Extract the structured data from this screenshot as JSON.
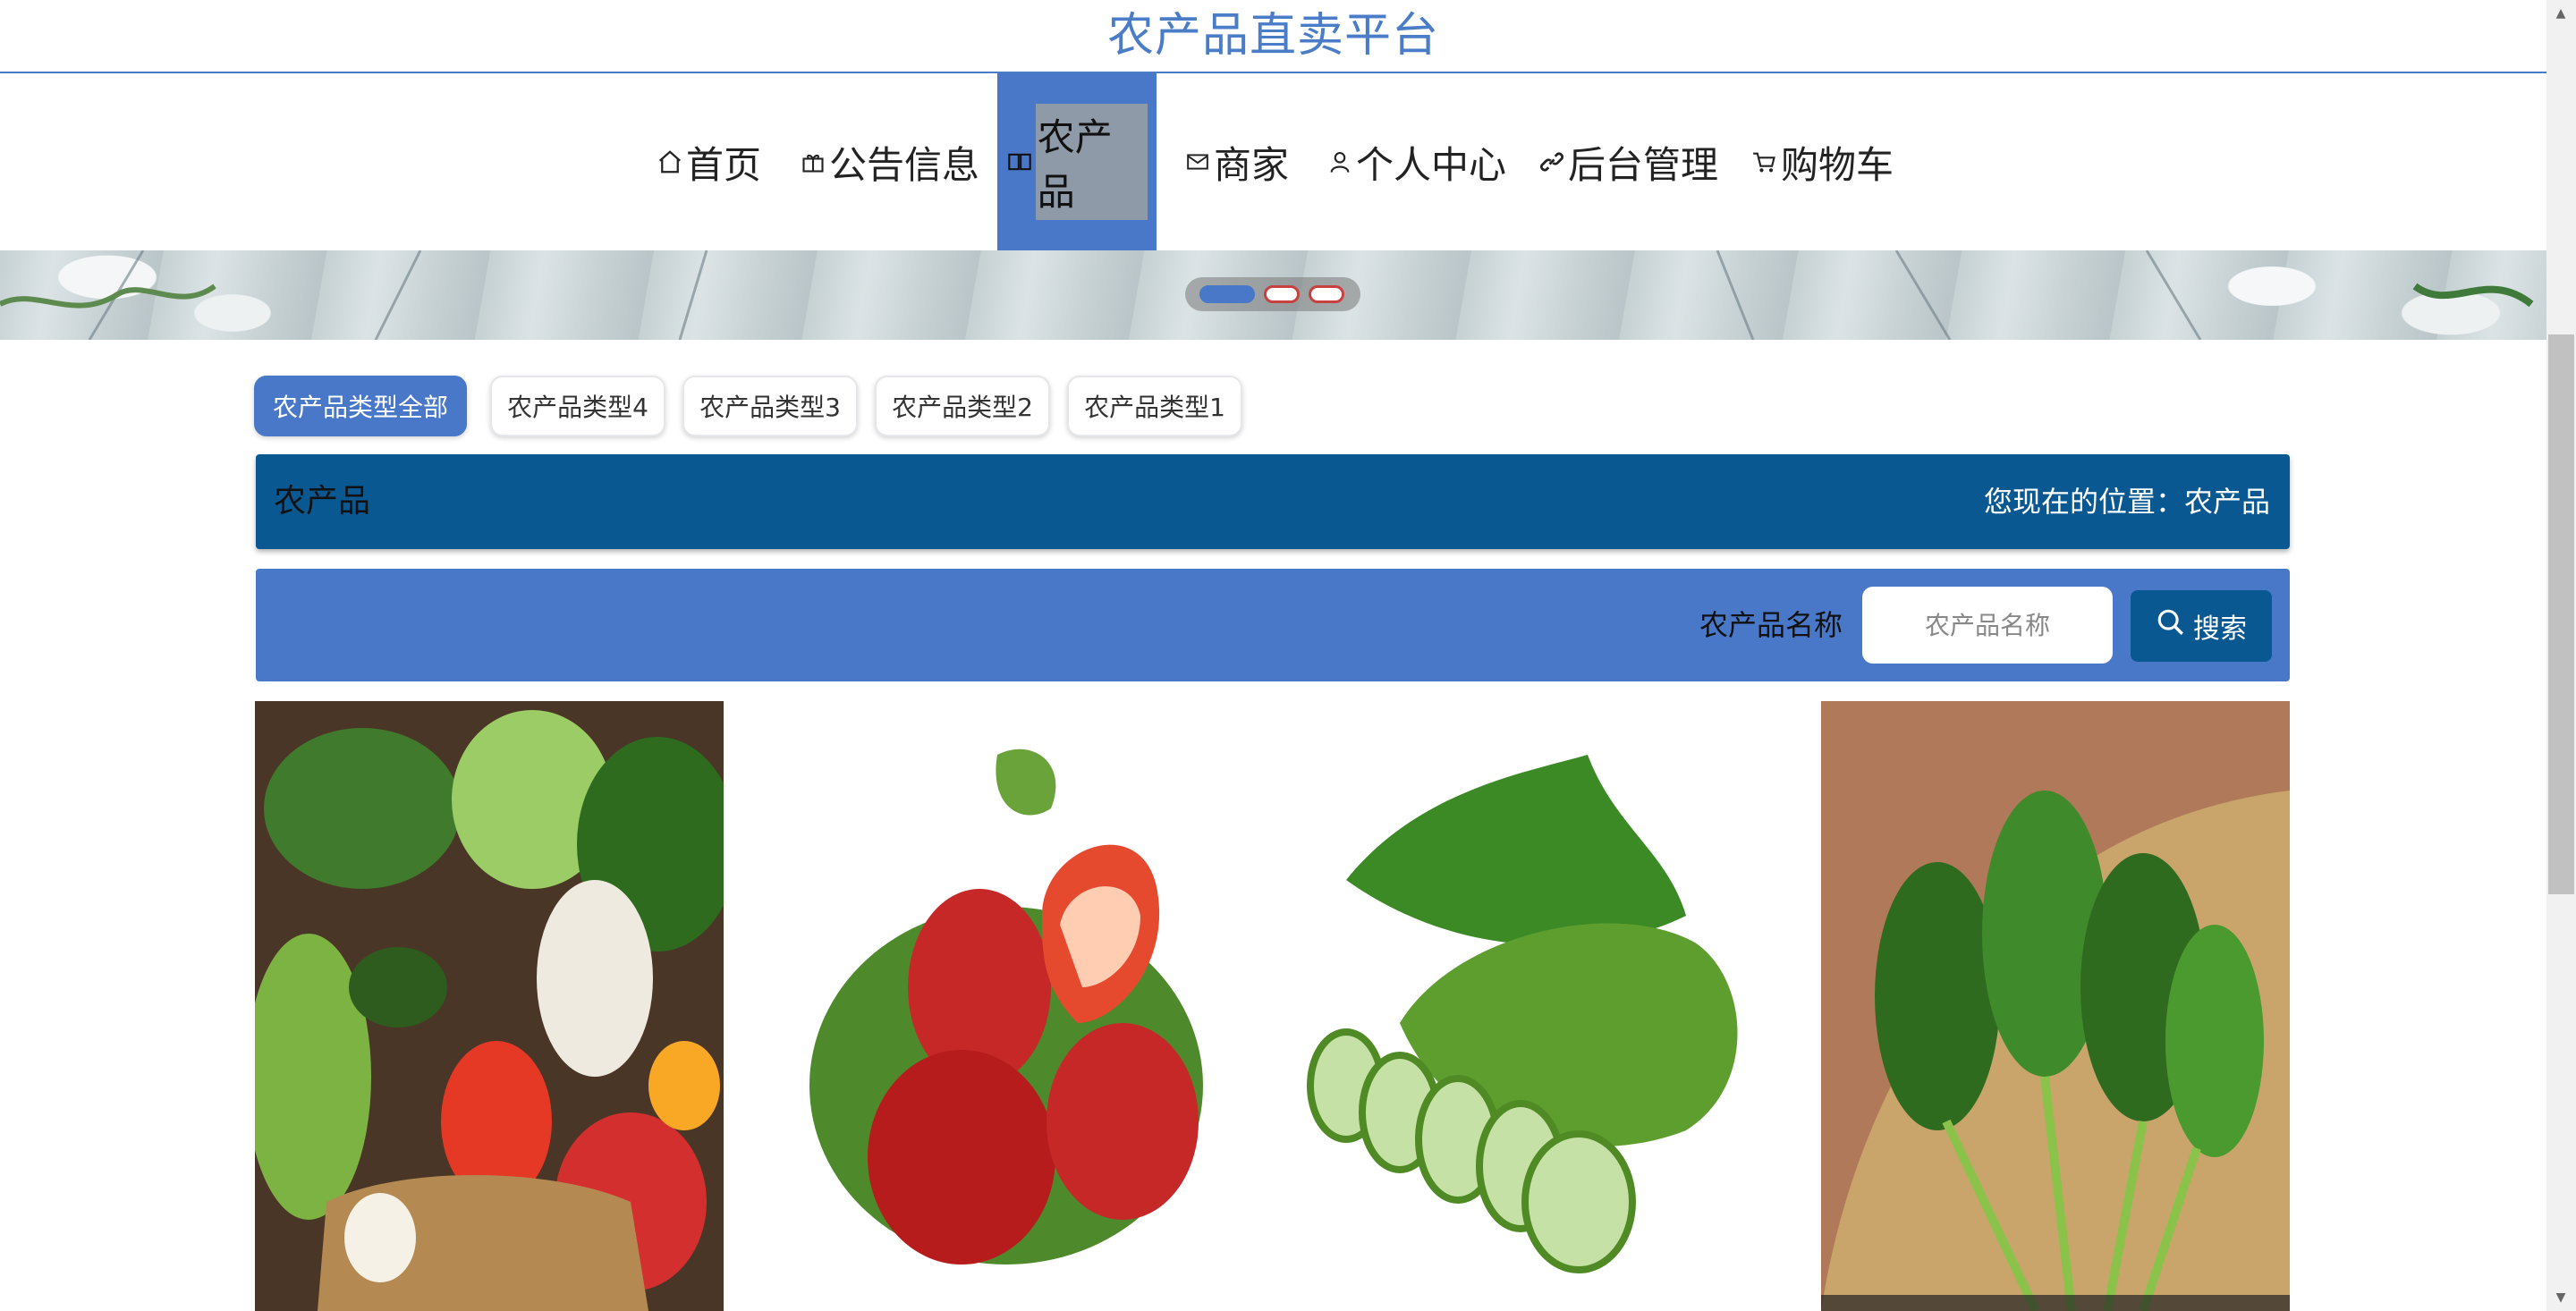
{
  "site": {
    "title": "农产品直卖平台"
  },
  "nav": {
    "items": [
      {
        "label": "首页",
        "icon": "home-icon"
      },
      {
        "label": "公告信息",
        "icon": "gift-icon"
      },
      {
        "label": "农产品",
        "icon": "book-icon",
        "active": true
      },
      {
        "label": "商家",
        "icon": "mail-icon"
      },
      {
        "label": "个人中心",
        "icon": "user-icon"
      },
      {
        "label": "后台管理",
        "icon": "link-icon"
      },
      {
        "label": "购物车",
        "icon": "cart-icon"
      }
    ]
  },
  "banner": {
    "dots": 3,
    "active_dot": 0
  },
  "categories": {
    "items": [
      "农产品类型全部",
      "农产品类型4",
      "农产品类型3",
      "农产品类型2",
      "农产品类型1"
    ],
    "active": 0
  },
  "location": {
    "title": "农产品",
    "path": "您现在的位置：农产品"
  },
  "search": {
    "label": "农产品名称",
    "placeholder": "农产品名称",
    "value": "",
    "button_label": "搜索",
    "button_icon": "search-icon"
  },
  "products": [
    {
      "name": "mixed-vegetables"
    },
    {
      "name": "strawberries"
    },
    {
      "name": "cucumber"
    },
    {
      "name": "spinach"
    }
  ],
  "colors": {
    "accent": "#4a78c9",
    "dark": "#0a5891",
    "title": "#4a7cc7"
  }
}
